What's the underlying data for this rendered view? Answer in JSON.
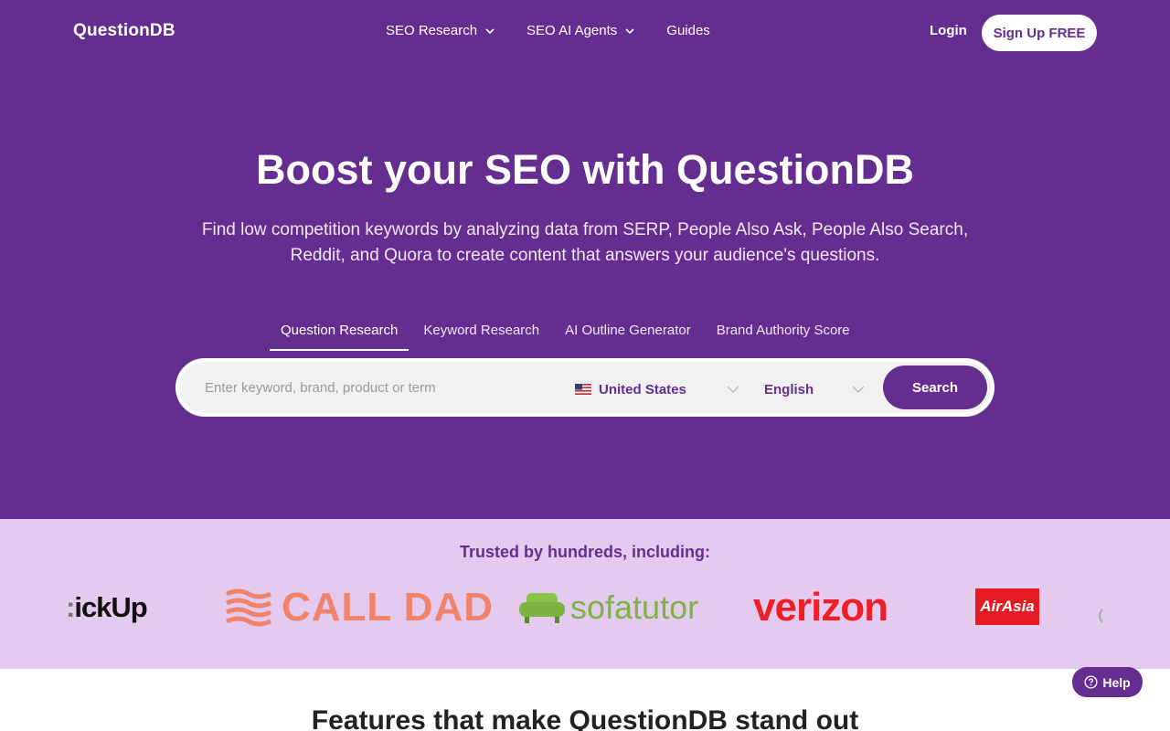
{
  "nav": {
    "logo": "QuestionDB",
    "links": [
      {
        "label": "SEO Research",
        "has_dropdown": true
      },
      {
        "label": "SEO AI Agents",
        "has_dropdown": true
      },
      {
        "label": "Guides",
        "has_dropdown": false
      }
    ],
    "login": "Login",
    "signup": "Sign Up FREE"
  },
  "hero": {
    "headline": "Boost your SEO with QuestionDB",
    "subtext": "Find low competition keywords by analyzing data from SERP, People Also Ask, People Also Search, Reddit, and Quora to create content that answers your audience's questions."
  },
  "tabs": [
    {
      "label": "Question Research",
      "active": true
    },
    {
      "label": "Keyword Research",
      "active": false
    },
    {
      "label": "AI Outline Generator",
      "active": false
    },
    {
      "label": "Brand Authority Score",
      "active": false
    }
  ],
  "search": {
    "placeholder": "Enter keyword, brand, product or term",
    "value": "",
    "country": "United States",
    "country_icon": "us-flag-icon",
    "language": "English",
    "button": "Search"
  },
  "trusted": {
    "title": "Trusted by hundreds, including:",
    "logos": [
      {
        "name": "ClickUp",
        "text": "ickUp"
      },
      {
        "name": "Call Dad",
        "text": "CALL DAD"
      },
      {
        "name": "sofatutor",
        "text": "sofatutor"
      },
      {
        "name": "Verizon",
        "text": "verizon"
      },
      {
        "name": "AirAsia",
        "text": "AirAsia"
      }
    ]
  },
  "features": {
    "title": "Features that make QuestionDB stand out"
  },
  "help": {
    "label": "Help",
    "icon": "question-circle-icon"
  },
  "colors": {
    "brand": "#652d90",
    "trusted_bg": "#e4caee",
    "search_bg": "#f1f1f1"
  }
}
